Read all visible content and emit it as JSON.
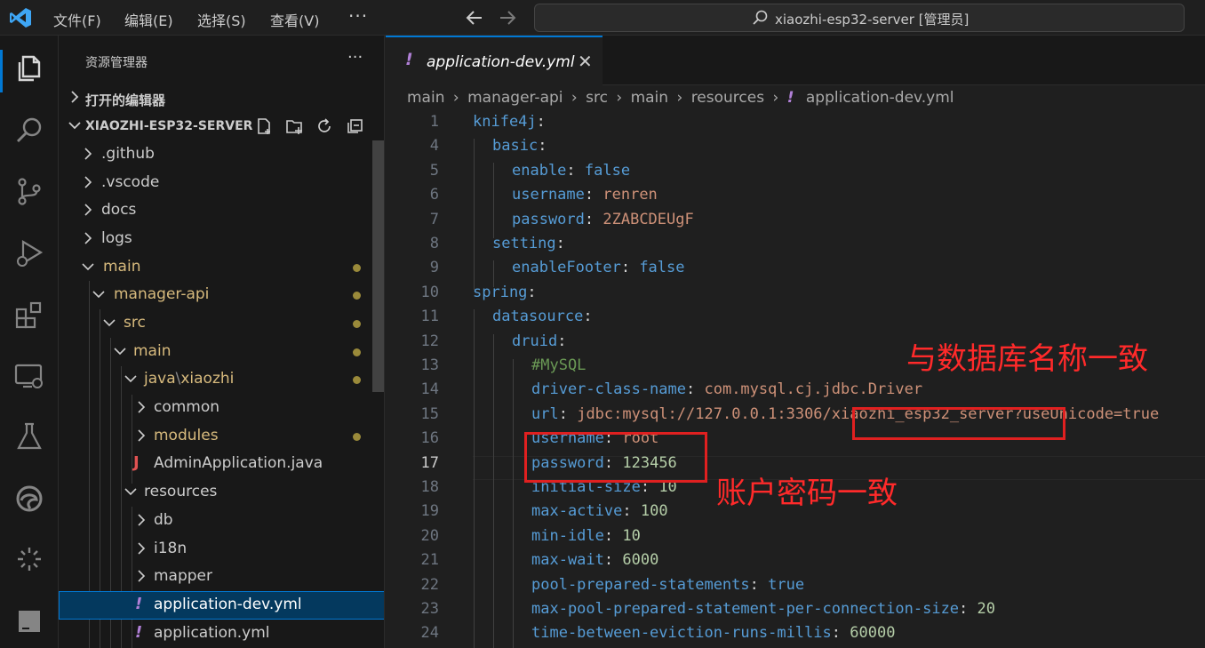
{
  "titlebar": {
    "menus": [
      "文件(F)",
      "编辑(E)",
      "选择(S)",
      "查看(V)"
    ],
    "more": "···",
    "search_text": "xiaozhi-esp32-server [管理员]"
  },
  "sidebar": {
    "title": "资源管理器",
    "more": "···",
    "open_editors": "打开的编辑器",
    "project": "XIAOZHI-ESP32-SERVER",
    "tree": [
      {
        "label": ".github"
      },
      {
        "label": ".vscode"
      },
      {
        "label": "docs"
      },
      {
        "label": "logs"
      },
      {
        "label": "main"
      },
      {
        "label": "manager-api"
      },
      {
        "label": "src"
      },
      {
        "label": "main"
      },
      {
        "label": "java",
        "sep": "\\",
        "label2": "xiaozhi"
      },
      {
        "label": "common"
      },
      {
        "label": "modules"
      },
      {
        "label": "AdminApplication.java",
        "icon": "J"
      },
      {
        "label": "resources"
      },
      {
        "label": "db"
      },
      {
        "label": "i18n"
      },
      {
        "label": "mapper"
      },
      {
        "label": "application-dev.yml",
        "icon": "!"
      },
      {
        "label": "application.yml",
        "icon": "!"
      }
    ]
  },
  "editor": {
    "tab_icon": "!",
    "tab_label": "application-dev.yml",
    "tab_close": "✕",
    "breadcrumb": [
      "main",
      "manager-api",
      "src",
      "main",
      "resources",
      "application-dev.yml"
    ],
    "breadcrumb_sep": "›",
    "line_numbers": [
      "1",
      "4",
      "5",
      "6",
      "7",
      "8",
      "9",
      "10",
      "11",
      "12",
      "13",
      "14",
      "15",
      "16",
      "17",
      "18",
      "19",
      "20",
      "21",
      "22",
      "23",
      "24"
    ],
    "lines": [
      {
        "key": "knife4j",
        "colon": ":",
        "val": ""
      },
      {
        "key": "basic",
        "colon": ":",
        "val": ""
      },
      {
        "key": "enable",
        "colon": ": ",
        "val": "false"
      },
      {
        "key": "username",
        "colon": ": ",
        "val": "renren"
      },
      {
        "key": "password",
        "colon": ": ",
        "val": "2ZABCDEUgF"
      },
      {
        "key": "setting",
        "colon": ":",
        "val": ""
      },
      {
        "key": "enableFooter",
        "colon": ": ",
        "val": "false"
      },
      {
        "key": "spring",
        "colon": ":",
        "val": ""
      },
      {
        "key": "datasource",
        "colon": ":",
        "val": ""
      },
      {
        "key": "druid",
        "colon": ":",
        "val": ""
      },
      {
        "key": "",
        "colon": "",
        "val": "#MySQL"
      },
      {
        "key": "driver-class-name",
        "colon": ": ",
        "val": "com.mysql.cj.jdbc.Driver"
      },
      {
        "key": "url",
        "colon": ": ",
        "val": "jdbc:mysql://127.0.0.1:3306/xiaozhi_esp32_server?useUnicode=true"
      },
      {
        "key": "username",
        "colon": ": ",
        "val": "root"
      },
      {
        "key": "password",
        "colon": ": ",
        "val": "123456"
      },
      {
        "key": "initial-size",
        "colon": ": ",
        "val": "10"
      },
      {
        "key": "max-active",
        "colon": ": ",
        "val": "100"
      },
      {
        "key": "min-idle",
        "colon": ": ",
        "val": "10"
      },
      {
        "key": "max-wait",
        "colon": ": ",
        "val": "6000"
      },
      {
        "key": "pool-prepared-statements",
        "colon": ": ",
        "val": "true"
      },
      {
        "key": "max-pool-prepared-statement-per-connection-size",
        "colon": ": ",
        "val": "20"
      },
      {
        "key": "time-between-eviction-runs-millis",
        "colon": ": ",
        "val": "60000"
      }
    ]
  },
  "annotations": {
    "db_name_note": "与数据库名称一致",
    "account_note": "账户密码一致"
  },
  "colors": {
    "accent": "#0078d4",
    "annotation_red": "#e02020",
    "folder_modified": "#d7ba7d"
  }
}
